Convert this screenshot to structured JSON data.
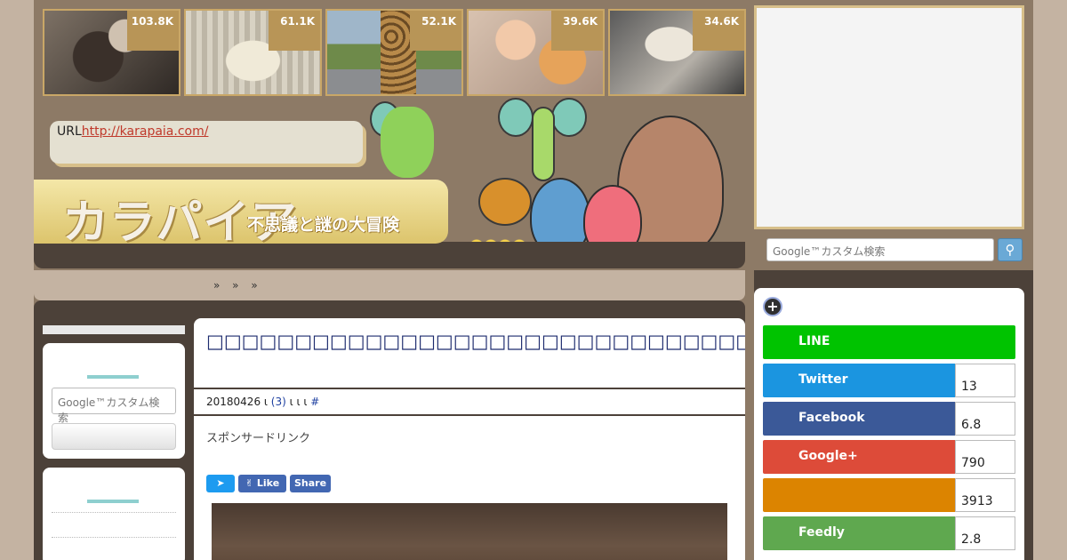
{
  "thumbnails": [
    {
      "count": "103.8K"
    },
    {
      "count": "61.1K"
    },
    {
      "count": "52.1K"
    },
    {
      "count": "39.6K"
    },
    {
      "count": "34.6K"
    }
  ],
  "url_box": {
    "prefix": "URL",
    "link": "http://karapaia.com/"
  },
  "logo": {
    "name": "カラパイア",
    "tagline": "不思議と謎の大冒険"
  },
  "breadcrumb": "»  »    »",
  "search": {
    "placeholder": "Google™カスタム検索",
    "button_icon": "search-icon"
  },
  "left_sidebar": {
    "search_placeholder": "Google™カスタム検索"
  },
  "article": {
    "title": "□□□□□□□□□□□□□□□□□□□□□□□□□□□□□□□□□□□□□□□□□□□□□□□□□",
    "date": "20180426",
    "meta_sep1": " ι ",
    "comments": "(3)",
    "meta_sep2": " ι  ι     ι ",
    "hash": "#",
    "sponsor": "スポンサードリンク",
    "share": {
      "like": "Like",
      "share": "Share"
    }
  },
  "share_panel": {
    "rows": [
      {
        "name": "LINE",
        "count": "",
        "color": "#00c300"
      },
      {
        "name": "Twitter",
        "count": "13",
        "color": "#1b95e0"
      },
      {
        "name": "Facebook",
        "count": "6.8",
        "color": "#3b5998"
      },
      {
        "name": "Google+",
        "count": "790",
        "color": "#dd4b39"
      },
      {
        "name": "",
        "count": "3913",
        "color": "#dc8400"
      },
      {
        "name": "Feedly",
        "count": "2.8",
        "color": "#5fa84f"
      }
    ]
  }
}
